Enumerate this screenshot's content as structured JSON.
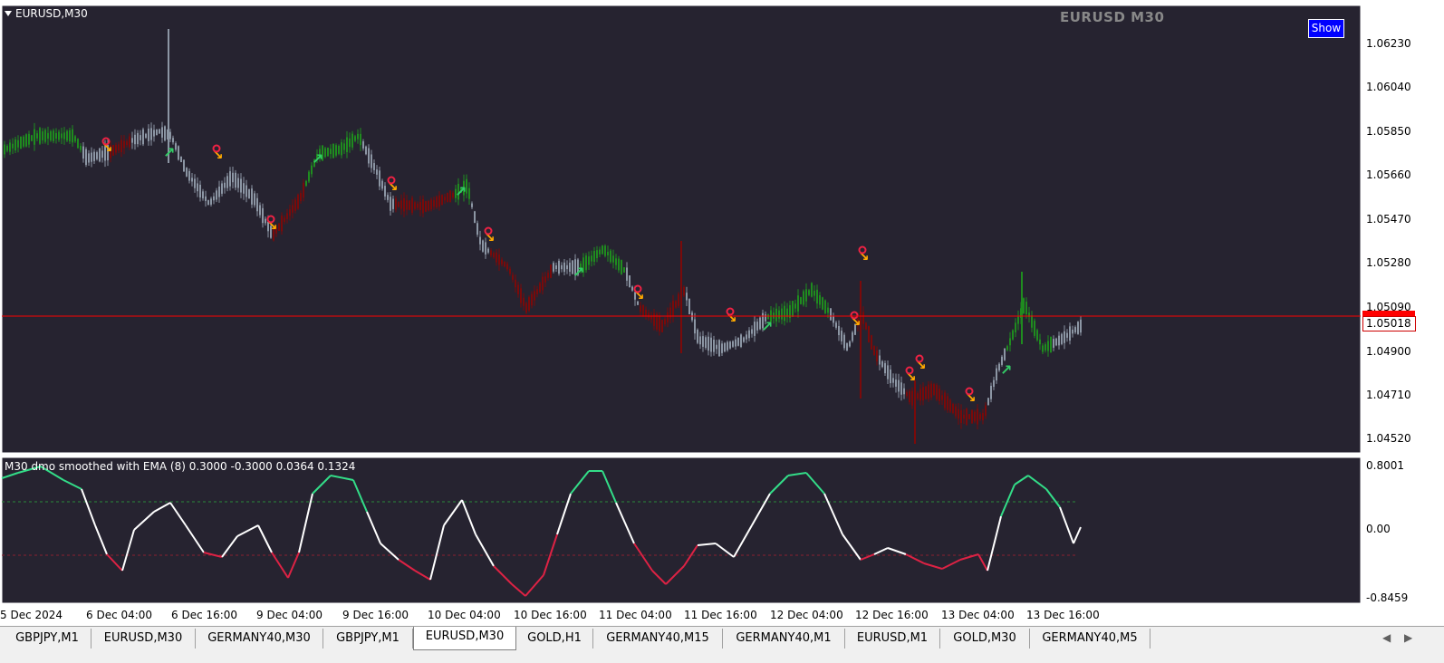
{
  "chart": {
    "symbol_label": "EURUSD,M30",
    "watermark": "EURUSD M30",
    "show_button": "Show",
    "indicator_label": "M30 dmo smoothed with EMA (8) 0.3000 -0.3000 0.0364 0.1324",
    "current_price": "1.05018",
    "price_axis": [
      "1.06230",
      "1.06040",
      "1.05850",
      "1.05660",
      "1.05470",
      "1.05280",
      "1.05090",
      "1.04900",
      "1.04710",
      "1.04520"
    ],
    "indicator_axis": [
      "0.8001",
      "0.00",
      "-0.8459"
    ],
    "time_axis": [
      "5 Dec 2024",
      "6 Dec 04:00",
      "6 Dec 16:00",
      "9 Dec 04:00",
      "9 Dec 16:00",
      "10 Dec 04:00",
      "10 Dec 16:00",
      "11 Dec 04:00",
      "11 Dec 16:00",
      "12 Dec 04:00",
      "12 Dec 16:00",
      "13 Dec 04:00",
      "13 Dec 16:00"
    ],
    "colors": {
      "background": "#262330",
      "bull": "#1f8c1f",
      "bear": "#7a0a0a",
      "neutral": "#8c96a4",
      "price_line": "#ff0000",
      "osc_up": "#33dd88",
      "osc_mid": "#ffffff",
      "osc_down": "#dd2244"
    }
  },
  "tabs": [
    {
      "label": "GBPJPY,M1",
      "active": false
    },
    {
      "label": "EURUSD,M30",
      "active": false
    },
    {
      "label": "GERMANY40,M30",
      "active": false
    },
    {
      "label": "GBPJPY,M1",
      "active": false
    },
    {
      "label": "EURUSD,M30",
      "active": true
    },
    {
      "label": "GOLD,H1",
      "active": false
    },
    {
      "label": "GERMANY40,M15",
      "active": false
    },
    {
      "label": "GERMANY40,M1",
      "active": false
    },
    {
      "label": "EURUSD,M1",
      "active": false
    },
    {
      "label": "GOLD,M30",
      "active": false
    },
    {
      "label": "GERMANY40,M5",
      "active": false
    }
  ]
}
